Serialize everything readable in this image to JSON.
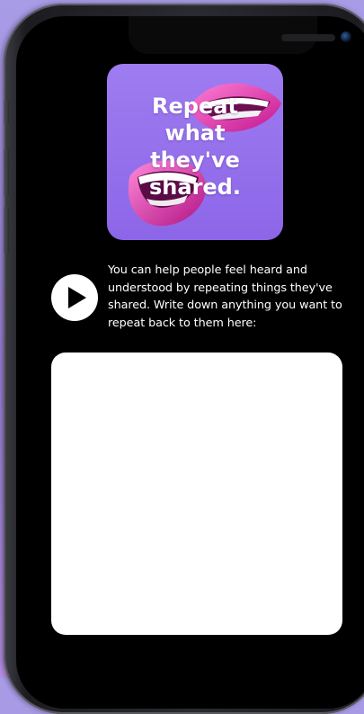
{
  "hero": {
    "title": "Repeat\nwhat\nthey've\nshared.",
    "image_icon": "lips-icon",
    "accent_color": "#8c66e8"
  },
  "play_button": {
    "icon": "play-icon"
  },
  "instructions": {
    "text": "You can help people feel heard and understood by repeating things they've shared. Write down anything you want to repeat back to them here:"
  },
  "notes": {
    "value": "",
    "placeholder": ""
  }
}
